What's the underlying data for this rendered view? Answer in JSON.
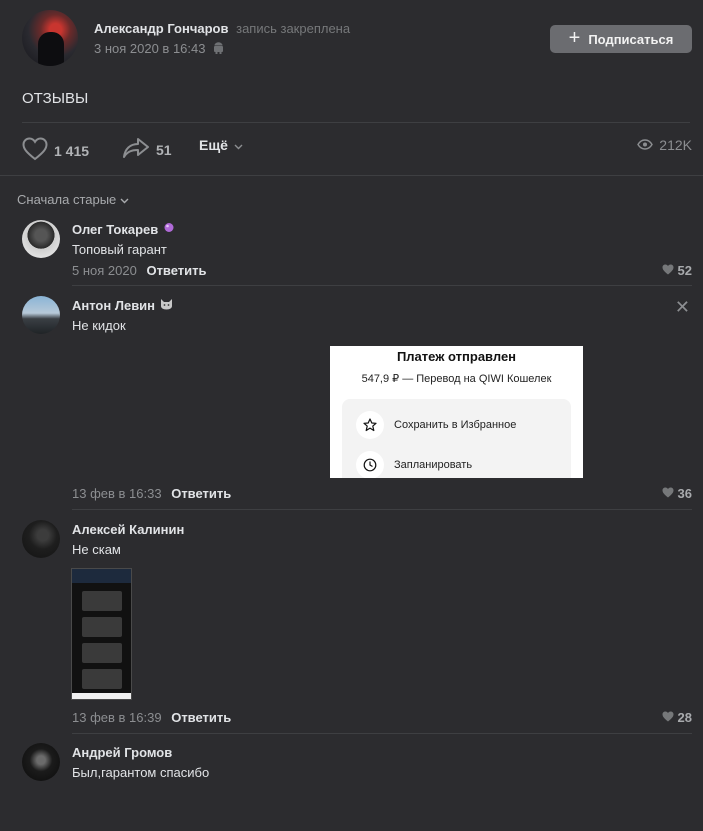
{
  "post": {
    "author": "Александр Гончаров",
    "pinned_label": "запись закреплена",
    "date": "3 ноя 2020 в 16:43",
    "subscribe_label": "Подписаться",
    "text": "ОТЗЫВЫ",
    "likes": "1 415",
    "shares": "51",
    "more_label": "Ещё",
    "views": "212K"
  },
  "sort_label": "Сначала старые",
  "comments": [
    {
      "name": "Олег Токарев",
      "text": "Топовый гарант",
      "date": "5 ноя 2020",
      "reply_label": "Ответить",
      "likes": "52"
    },
    {
      "name": "Антон Левин",
      "text": "Не кидок",
      "date": "13 фев в 16:33",
      "reply_label": "Ответить",
      "likes": "36",
      "attachment": {
        "title": "Платеж отправлен",
        "subtitle": "547,9 ₽ — Перевод на QIWI Кошелек",
        "row1": "Сохранить в Избранное",
        "row2": "Запланировать"
      }
    },
    {
      "name": "Алексей Калинин",
      "text": "Не скам",
      "date": "13 фев в 16:39",
      "reply_label": "Ответить",
      "likes": "28"
    },
    {
      "name": "Андрей Громов",
      "text": "Был,гарантом спасибо"
    }
  ],
  "icons": {
    "like": "heart-icon",
    "share": "share-arrow-icon",
    "views": "eye-icon",
    "close": "close-icon",
    "android": "android-icon"
  }
}
